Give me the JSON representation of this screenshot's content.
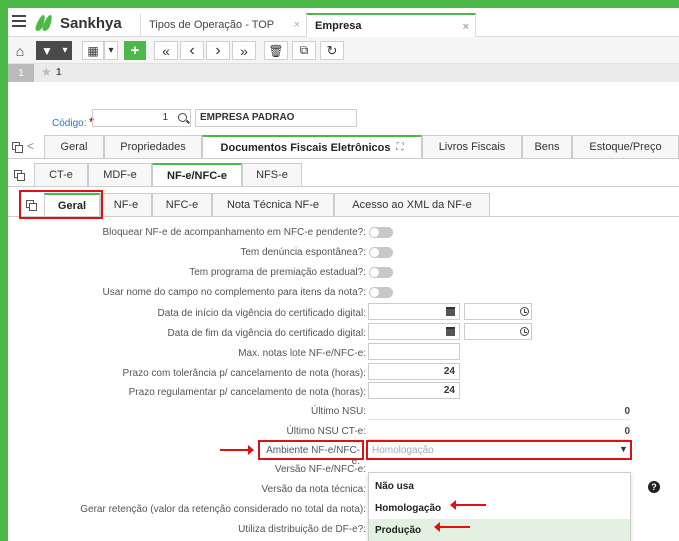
{
  "app": {
    "brand": "Sankhya"
  },
  "window_tabs": [
    {
      "label": "Tipos de Operação - TOP"
    },
    {
      "label": "Empresa"
    }
  ],
  "close_glyph": "×",
  "toolbar": {
    "filter_glyph": "▼",
    "caret_glyph": "▾",
    "grid_glyph": "▦",
    "add_glyph": "+",
    "first_glyph": "«",
    "prev_glyph": "‹",
    "next_glyph": "›",
    "last_glyph": "»",
    "delete_glyph": "🗑",
    "clone_glyph": "⧉",
    "refresh_glyph": "↻",
    "home_glyph": "⌂"
  },
  "record": {
    "index": "1",
    "star_label": "1"
  },
  "codigo": {
    "label": "Código:",
    "required_mark": "*",
    "value": "1",
    "empresa": "EMPRESA PADRAO"
  },
  "main_tabs": [
    "Geral",
    "Propriedades",
    "Documentos Fiscais Eletrônicos",
    "Livros Fiscais",
    "Bens",
    "Estoque/Preço"
  ],
  "main_tabs_nav_glyph": "<",
  "main_tabs_expand_glyph": "⛶",
  "doc_tabs": [
    "CT-e",
    "MDF-e",
    "NF-e/NFC-e",
    "NFS-e"
  ],
  "sub_tabs": [
    "Geral",
    "NF-e",
    "NFC-e",
    "Nota Técnica NF-e",
    "Acesso ao XML da NF-e"
  ],
  "form": {
    "bloquear": "Bloquear NF-e de acompanhamento em NFC-e pendente?:",
    "denuncia": "Tem denúncia espontânea?:",
    "premiacao": "Tem programa de premiação estadual?:",
    "usar_nome": "Usar nome do campo no complemento para itens da nota?:",
    "inicio_cert": "Data de início da vigência do certificado digital:",
    "fim_cert": "Data de fim da vigência do certificado digital:",
    "max_lote": "Max. notas lote NF-e/NFC-e:",
    "prazo_tol": "Prazo com tolerância p/ cancelamento de nota (horas):",
    "prazo_tol_value": "24",
    "prazo_reg": "Prazo regulamentar p/ cancelamento de nota (horas):",
    "prazo_reg_value": "24",
    "ultimo_nsu": "Último NSU:",
    "ultimo_nsu_value": "0",
    "ultimo_nsu_cte": "Último NSU CT-e:",
    "ultimo_nsu_cte_value": "0",
    "ambiente": "Ambiente NF-e/NFC-e:",
    "ambiente_value": "Homologação",
    "versao": "Versão NF-e/NFC-e:",
    "versao_tecnica": "Versão da nota técnica:",
    "gerar_retencao": "Gerar retenção (valor da retenção considerado no total da nota):",
    "distribuicao": "Utiliza distribuição de DF-e?:"
  },
  "dropdown_options": [
    "Não usa",
    "Homologação",
    "Produção"
  ],
  "help_glyph": "?",
  "colors": {
    "brand_green": "#4cb848",
    "highlight_red": "#e01010",
    "selected_option": "#e2f1e0"
  }
}
